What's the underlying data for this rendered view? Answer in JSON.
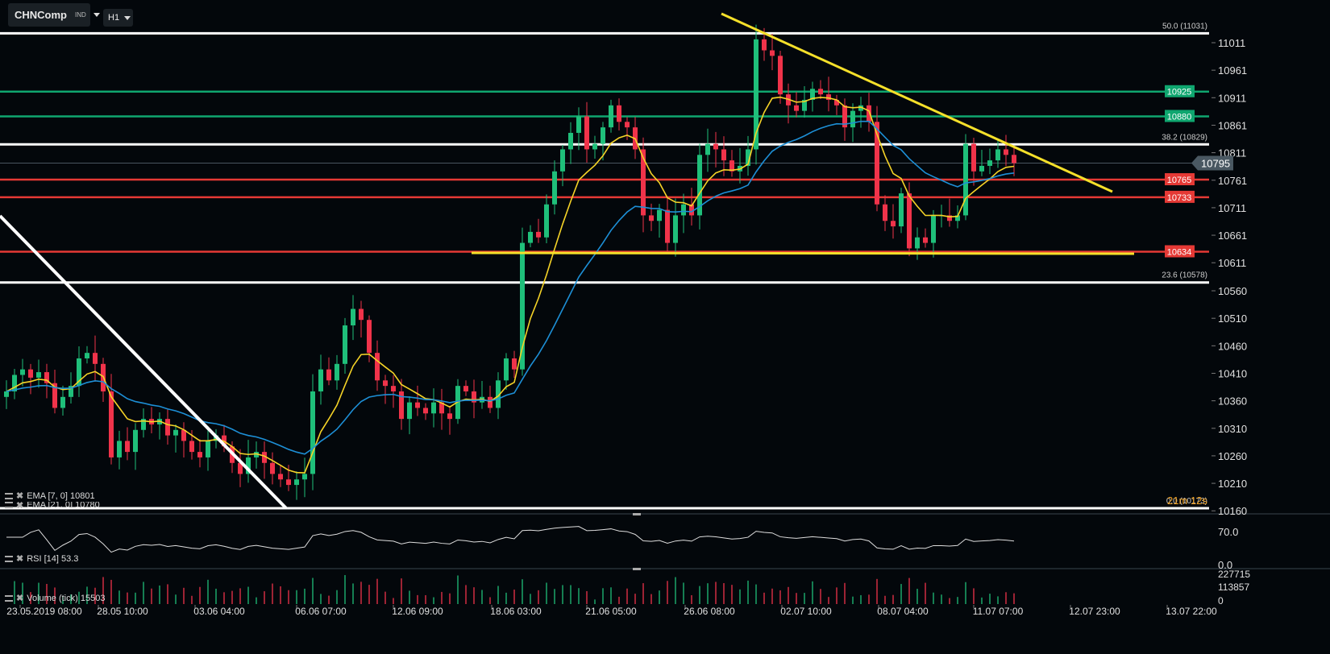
{
  "toolbar": {
    "symbol": "CHNComp",
    "symbol_type": "IND",
    "timeframe": "H1"
  },
  "legend": {
    "ema7": "EMA [7, 0] 10801",
    "ema21": "EMA [21, 0] 10780",
    "rsi": "RSI [14] 53.3",
    "volume": "Volume (tick) 15503"
  },
  "colors": {
    "up": "#1fbf7a",
    "down": "#f0334a",
    "ema7": "#f5d327",
    "ema21": "#1d8fd6",
    "support_green": "#0fa66f",
    "resistance_red": "#e53935",
    "fib": "#ffffff",
    "trend": "#f5e02a",
    "price_tag": "#4a5862"
  },
  "chart_data": {
    "type": "candlestick",
    "symbol": "CHNComp",
    "timeframe": "H1",
    "ylim": [
      10160,
      11031
    ],
    "y_ticks": [
      11011,
      10961,
      10911,
      10861,
      10811,
      10761,
      10711,
      10661,
      10611,
      10560,
      10510,
      10460,
      10410,
      10360,
      10310,
      10260,
      10210,
      10160
    ],
    "x_ticks": [
      "23.05.2019  08:00",
      "28.05  10:00",
      "03.06  04:00",
      "06.06  07:00",
      "12.06  09:00",
      "18.06  03:00",
      "21.06  05:00",
      "26.06  08:00",
      "02.07  10:00",
      "08.07  04:00",
      "11.07  07:00",
      "12.07  23:00",
      "13.07  22:00"
    ],
    "closes": [
      10380,
      10410,
      10420,
      10405,
      10415,
      10395,
      10350,
      10370,
      10390,
      10440,
      10450,
      10430,
      10380,
      10260,
      10290,
      10270,
      10310,
      10330,
      10320,
      10330,
      10300,
      10310,
      10290,
      10270,
      10260,
      10290,
      10300,
      10280,
      10250,
      10230,
      10260,
      10270,
      10250,
      10230,
      10220,
      10210,
      10220,
      10230,
      10380,
      10420,
      10400,
      10430,
      10500,
      10530,
      10510,
      10450,
      10400,
      10390,
      10380,
      10330,
      10360,
      10350,
      10340,
      10360,
      10340,
      10330,
      10390,
      10380,
      10360,
      10370,
      10350,
      10400,
      10440,
      10420,
      10650,
      10670,
      10660,
      10720,
      10780,
      10820,
      10850,
      10880,
      10820,
      10830,
      10860,
      10900,
      10870,
      10860,
      10820,
      10700,
      10690,
      10710,
      10650,
      10700,
      10720,
      10700,
      10810,
      10830,
      10820,
      10800,
      10780,
      10790,
      10820,
      11020,
      11000,
      10990,
      10920,
      10900,
      10890,
      10910,
      10930,
      10920,
      10910,
      10900,
      10860,
      10890,
      10900,
      10870,
      10720,
      10690,
      10680,
      10740,
      10640,
      10660,
      10650,
      10700,
      10700,
      10690,
      10700,
      10830,
      10780,
      10790,
      10800,
      10820,
      10810,
      10795
    ],
    "current_price": 10795,
    "levels": [
      {
        "kind": "fib",
        "label": "50.0 (11031)",
        "price": 11031
      },
      {
        "kind": "fib",
        "label": "38.2 (10829)",
        "price": 10829
      },
      {
        "kind": "fib",
        "label": "23.6 (10578)",
        "price": 10578
      },
      {
        "kind": "fib",
        "label": "0.0 (10173)",
        "price": 10173
      },
      {
        "kind": "green",
        "label": "10925",
        "price": 10925
      },
      {
        "kind": "green",
        "label": "10880",
        "price": 10880
      },
      {
        "kind": "red",
        "label": "10765",
        "price": 10765
      },
      {
        "kind": "red",
        "label": "10733",
        "price": 10733
      },
      {
        "kind": "red",
        "label": "10634",
        "price": 10634
      }
    ],
    "countdown": "21m 12s",
    "rsi": {
      "ticks": [
        "70.0",
        "0.0"
      ],
      "value": 53.3
    },
    "volume": {
      "ticks": [
        "227715",
        "113857",
        "0"
      ],
      "value": 15503
    }
  }
}
